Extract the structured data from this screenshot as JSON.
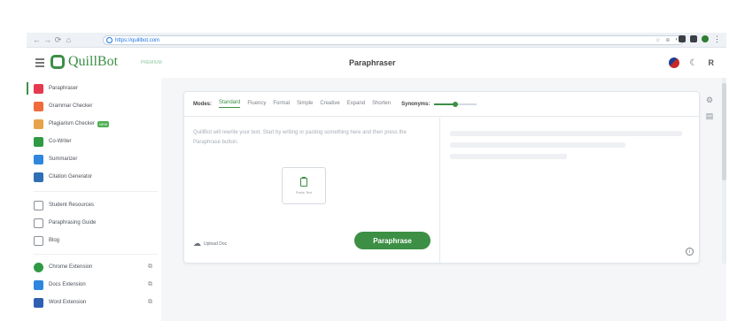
{
  "browser": {
    "nav": [
      "←",
      "→",
      "⟳",
      "⌂"
    ],
    "url": "https://quillbot.com",
    "url_icons": [
      "☆",
      "⊕",
      "◐"
    ],
    "menu_glyph": "⋮"
  },
  "header": {
    "brand": "QuillBot",
    "brand_badge": "PREMIUM",
    "title": "Paraphraser",
    "moon_glyph": "☾",
    "account_glyph": "R"
  },
  "sidebar": {
    "tools": [
      {
        "label": "Paraphraser",
        "color": "#e53950",
        "active": true
      },
      {
        "label": "Grammar Checker",
        "color": "#ef6c3a"
      },
      {
        "label": "Plagiarism Checker",
        "color": "#e8a34a",
        "badge": "NEW"
      },
      {
        "label": "Co-Writer",
        "color": "#2e9a43"
      },
      {
        "label": "Summarizer",
        "color": "#2e86de"
      },
      {
        "label": "Citation Generator",
        "color": "#2f6fb3"
      }
    ],
    "resources": [
      {
        "label": "Student Resources",
        "icon": "student-resources-icon"
      },
      {
        "label": "Paraphrasing Guide",
        "icon": "guide-icon"
      },
      {
        "label": "Blog",
        "icon": "blog-icon"
      }
    ],
    "extensions": [
      {
        "label": "Chrome Extension",
        "color": "#2e9a43"
      },
      {
        "label": "Docs Extension",
        "color": "#2e86de"
      },
      {
        "label": "Word Extension",
        "color": "#2f5fb3"
      }
    ],
    "ext_glyph": "⧉"
  },
  "modes": {
    "label": "Modes:",
    "items": [
      "Standard",
      "Fluency",
      "Formal",
      "Simple",
      "Creative",
      "Expand",
      "Shorten"
    ],
    "active": "Standard",
    "synonyms_label": "Synonyms:",
    "synonyms_level": 0.5
  },
  "input": {
    "placeholder": "QuillBot will rewrite your text. Start by writing or pasting something here and then press the Paraphrase button.",
    "paste_label": "Paste Text",
    "upload_label": "Upload Doc",
    "cloud_glyph": "☁"
  },
  "actions": {
    "paraphrase_label": "Paraphrase",
    "info_glyph": "i"
  },
  "right_rail": {
    "settings_glyph": "⚙",
    "compare_glyph": "▤"
  },
  "colors": {
    "accent": "#3d8f45",
    "background": "#f4f6f8"
  }
}
